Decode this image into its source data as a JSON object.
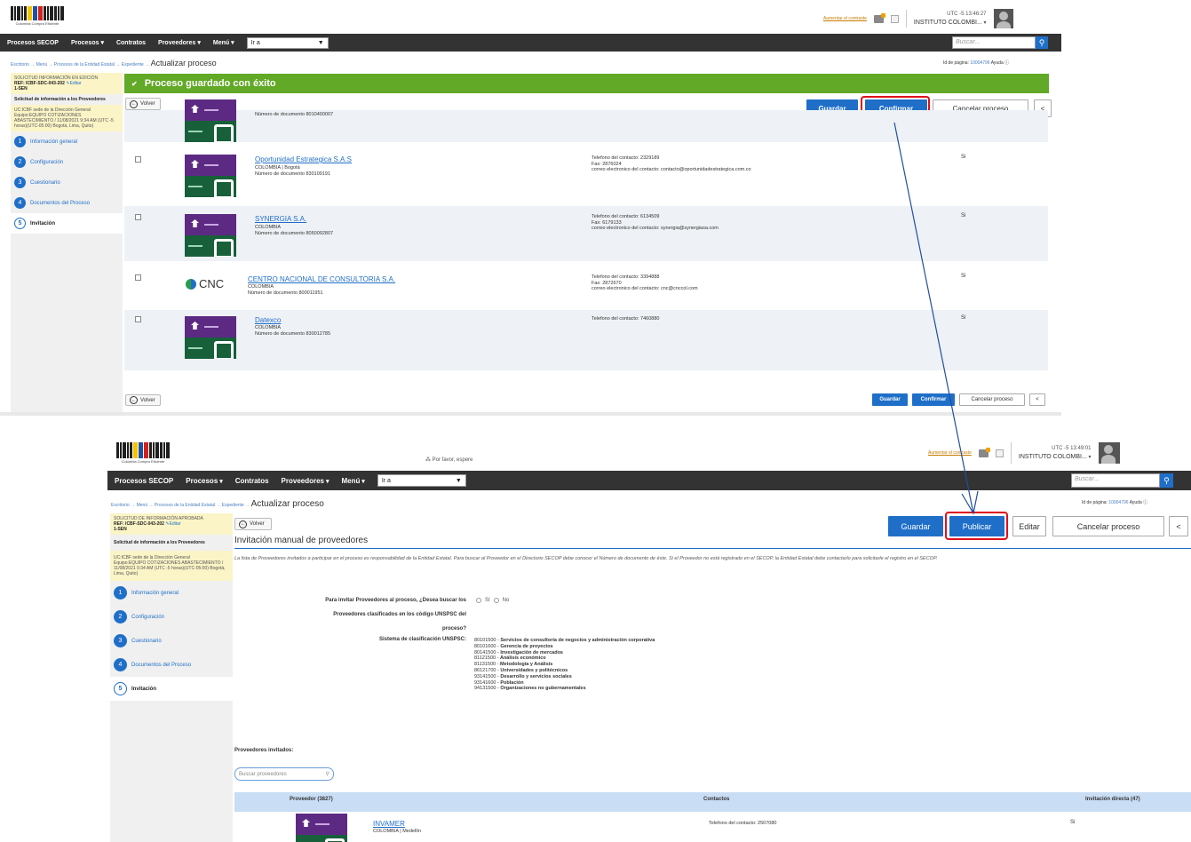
{
  "logo": {
    "caption": "Colombia Compra Eficiente"
  },
  "header": {
    "increase_contrast": "Aumentar el contraste",
    "entity": "INSTITUTO COLOMBI...",
    "search_placeholder": "Buscar..."
  },
  "nav": {
    "items": [
      "Procesos SECOP",
      "Procesos",
      "Contratos",
      "Proveedores",
      "Menú"
    ],
    "goto": "Ir a"
  },
  "breadcrumb": {
    "items": "Escritorio → Menú → Procesos de la Entidad Estatal → Expediente →",
    "current": "Actualizar proceso"
  },
  "page_id": {
    "label": "Id de página:",
    "value": "10004796",
    "help": "Ayuda"
  },
  "sidebar": {
    "status1": "SOLICITUD INFORMACIÓN EN EDICIÓN",
    "status2": "SOLICITUD DE INFORMACIÓN APROBADA",
    "ref": "REF: ICBF-SDC-043-202",
    "ref_suffix": "1-SEN",
    "edit": "Editar",
    "title": "Solicitud de información a los Proveedores",
    "uc": "UC:ICBF sede de la Dirección General",
    "team": "Equipo:EQUIPO COTIZACIONES ABASTECIMIENTO / 11/08/2021 9:34 AM (UTC -5 horas)(UTC-05:00) Bogotá, Lima, Quito)",
    "steps": [
      {
        "num": "1",
        "label": "Información general"
      },
      {
        "num": "2",
        "label": "Configuración"
      },
      {
        "num": "3",
        "label": "Cuestionario"
      },
      {
        "num": "4",
        "label": "Documentos del Proceso"
      },
      {
        "num": "5",
        "label": "Invitación"
      }
    ]
  },
  "screen1": {
    "clock": "UTC -5 13:46:27",
    "success": "Proceso guardado con éxito",
    "back": "Volver",
    "buttons": {
      "save": "Guardar",
      "confirm": "Confirmar",
      "cancel": "Cancelar proceso",
      "prev": "<"
    },
    "prev_row_text": "Número de documento 8010400007",
    "providers": [
      {
        "name": "Oportunidad Estrategica S.A.S",
        "loc": "COLOMBIA | Bogotá",
        "doc": "Número de documento 830109191",
        "contact": [
          "Telefono del contacto: 2329189",
          "Fax: 2876024",
          "correo electronico del contacto: contacto@oportunidadestrategica.com.co"
        ],
        "direct": "Si"
      },
      {
        "name": "SYNERGIA S.A.",
        "loc": "COLOMBIA",
        "doc": "Número de documento 8050092807",
        "contact": [
          "Telefono del contacto: 6134509",
          "Fax: 6179133",
          "correo electronico del contacto: synergia@synergiasa.com"
        ],
        "direct": "Si"
      },
      {
        "name": "CENTRO NACIONAL DE CONSULTORIA S.A.",
        "loc": "COLOMBIA",
        "doc": "Número de documento 800011951",
        "contact": [
          "Telefono del contacto: 3394888",
          "Fax: 2872670",
          "correo electronico del contacto: cnc@cnccol.com"
        ],
        "direct": "Si"
      },
      {
        "name": "Datexco",
        "loc": "COLOMBIA",
        "doc": "Número de documento 830012785",
        "contact": [
          "Telefono del contacto: 7460880"
        ],
        "direct": "Si"
      }
    ],
    "cnc_logo": "CNC"
  },
  "screen2": {
    "clock": "UTC -5 13:49:01",
    "wait": "Por favor, espere",
    "back": "Volver",
    "buttons": {
      "save": "Guardar",
      "publish": "Publicar",
      "edit": "Editar",
      "cancel": "Cancelar proceso",
      "prev": "<"
    },
    "section_title": "Invitación manual de proveedores",
    "description": "La lista de Proveedores invitados a participar en el proceso es responsabilidad de la Entidad Estatal. Para buscar al Proveedor en el Directorio SECOP debe conocer el Número de documento de éste. Si el Proveedor no está registrado en el SECOP, la Entidad Estatal debe contactarlo para solicitarle el registro en el SECOP.",
    "question": [
      "Para invitar Proveedores al proceso, ¿Desea buscar los",
      "Proveedores clasificados en los código UNSPSC del",
      "proceso?"
    ],
    "yes": "Sí",
    "no": "No",
    "unspsc_label": "Sistema de clasificación UNSPSC:",
    "unspsc": [
      {
        "code": "80101500 -",
        "name": "Servicios de consultoría de negocios y administración corporativa"
      },
      {
        "code": "80101600 -",
        "name": "Gerencia de proyectos"
      },
      {
        "code": "80141500 -",
        "name": "Investigación de mercados"
      },
      {
        "code": "81121500 -",
        "name": "Análisis económico"
      },
      {
        "code": "81131500 -",
        "name": "Metodología y Análisis"
      },
      {
        "code": "86121700 -",
        "name": "Universidades y politécnicos"
      },
      {
        "code": "93141500 -",
        "name": "Desarrollo y servicios sociales"
      },
      {
        "code": "93141600 -",
        "name": "Población"
      },
      {
        "code": "94131500 -",
        "name": "Organizaciones no gubernamentales"
      }
    ],
    "invited_label": "Proveedores invitados:",
    "search_providers": "Buscar proveedores",
    "table": {
      "col_provider": "Proveedor (3827)",
      "col_contacts": "Contactos",
      "col_direct": "Invitación directa (47)"
    },
    "first_row": {
      "name": "INVAMER",
      "loc": "COLOMBIA | Medellín",
      "contact": "Telefono del contacto: 2507080",
      "direct": "Si"
    }
  }
}
